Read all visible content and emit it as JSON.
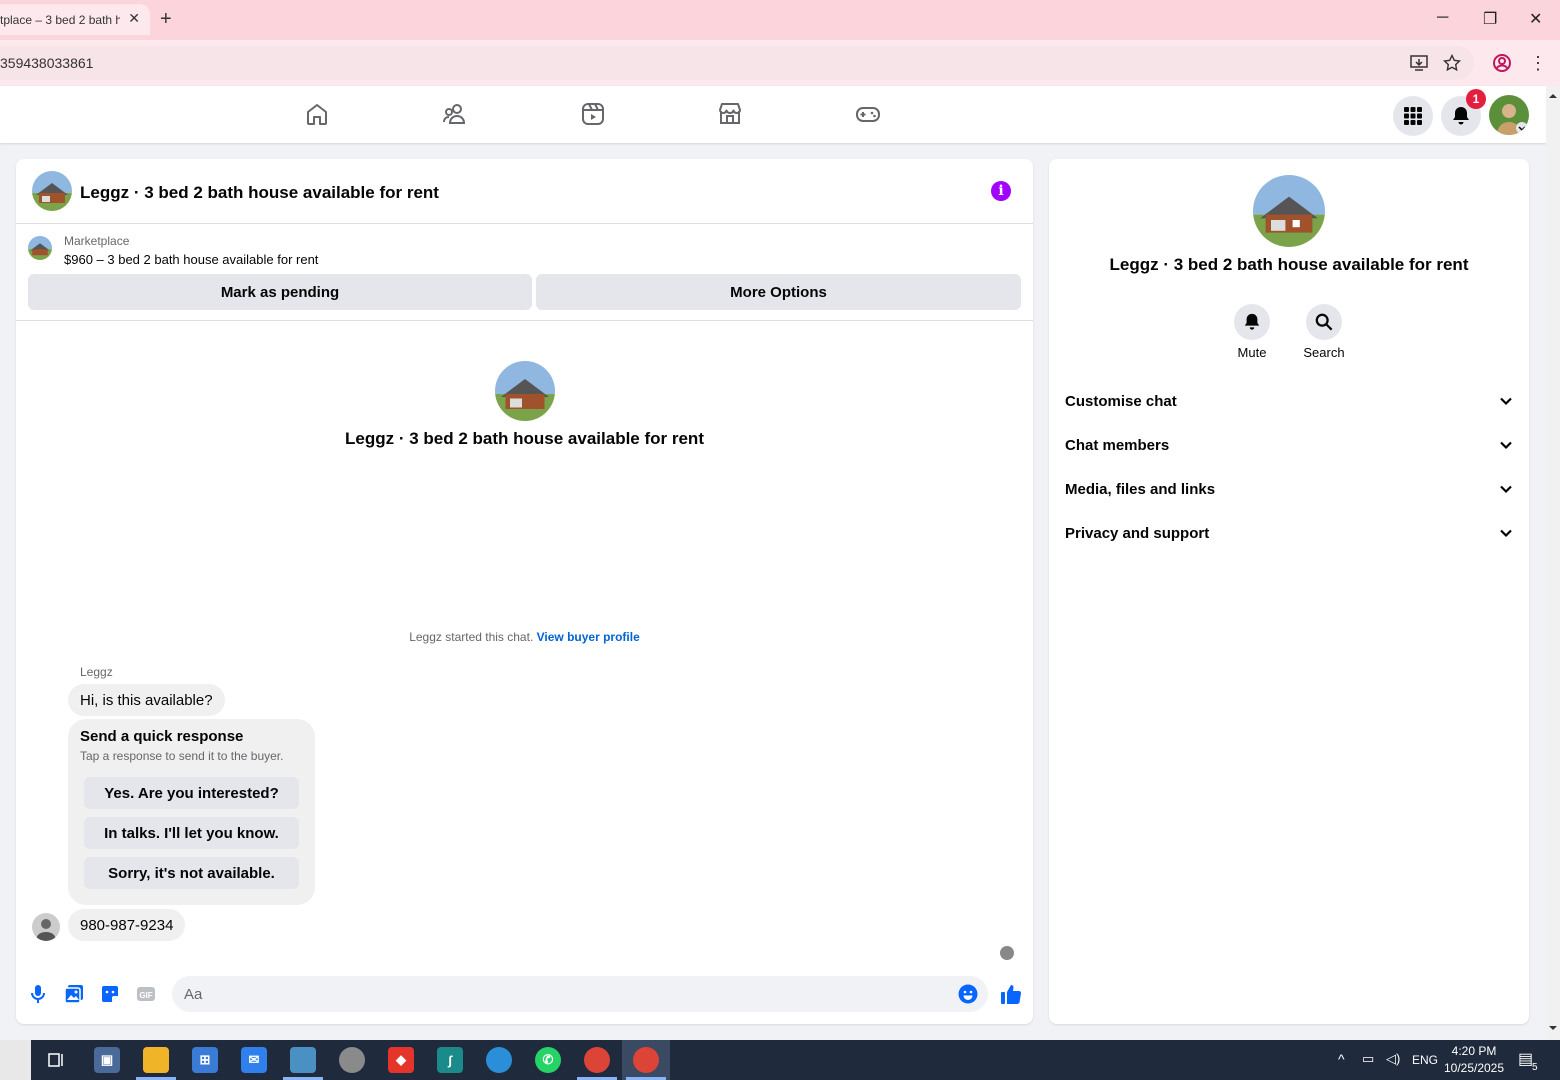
{
  "browser": {
    "tab_title": "tplace – 3 bed 2 bath h",
    "url": "359438033861"
  },
  "nav": {
    "notification_count": "1"
  },
  "chat": {
    "title": "Leggz · 3 bed 2 bath house available for rent",
    "marketplace_label": "Marketplace",
    "listing": "$960 – 3 bed 2 bath house available for rent",
    "mark_pending_label": "Mark as pending",
    "more_options_label": "More Options",
    "center_title": "Leggz · 3 bed 2 bath house available for rent",
    "started_text": "Leggz started this chat.",
    "view_profile_link": "View buyer profile",
    "sender_name": "Leggz",
    "first_message": "Hi, is this available?",
    "quick_response": {
      "title": "Send a quick response",
      "subtitle": "Tap a response to send it to the buyer.",
      "options": [
        "Yes. Are you interested?",
        "In talks. I'll let you know.",
        "Sorry, it's not available."
      ]
    },
    "second_message": "980-987-9234",
    "composer_placeholder": "Aa"
  },
  "info_panel": {
    "title": "Leggz · 3 bed 2 bath house available for rent",
    "mute_label": "Mute",
    "search_label": "Search",
    "sections": [
      "Customise chat",
      "Chat members",
      "Media, files and links",
      "Privacy and support"
    ]
  },
  "taskbar": {
    "language": "ENG",
    "time": "4:20 PM",
    "date": "10/25/2025",
    "notification_count": "5"
  },
  "colors": {
    "accent": "#0866ff",
    "info": "#a200ff",
    "badge": "#e41e3f"
  }
}
